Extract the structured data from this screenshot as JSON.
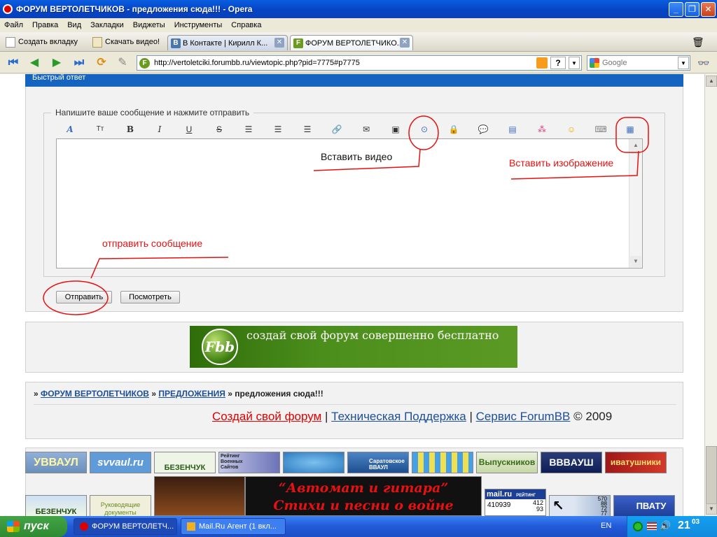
{
  "window": {
    "title": "ФОРУМ ВЕРТОЛЕТЧИКОВ - предложения сюда!!! - Opera",
    "buttons": {
      "minimize": "_",
      "maximize": "❐",
      "close": "✕"
    }
  },
  "menu": [
    "Файл",
    "Правка",
    "Вид",
    "Закладки",
    "Виджеты",
    "Инструменты",
    "Справка"
  ],
  "tabbar": {
    "new_tab": "Создать вкладку",
    "download_video": "Скачать видео!",
    "tabs": [
      {
        "label": "В Контакте | Кирилл К...",
        "favicon": "B",
        "active": false
      },
      {
        "label": "ФОРУМ ВЕРТОЛЕТЧИКО...",
        "favicon": "F",
        "active": true
      }
    ]
  },
  "address": {
    "url": "http://vertoletciki.forumbb.ru/viewtopic.php?pid=7775#p7775",
    "search_placeholder": "Google"
  },
  "page": {
    "quick_reply_title": "Быстрый ответ",
    "legend": "Напишите ваше сообщение и нажмите отправить",
    "submit_label": "Отправить",
    "preview_label": "Посмотреть",
    "annotations": {
      "insert_video": "Вставить видео",
      "insert_image": "Вставить изображение",
      "send_message": "отправить сообщение"
    },
    "promo_text": "создай свой форум совершенно бесплатно",
    "promo_logo": "Fbb",
    "breadcrumb": {
      "sep": "»",
      "forum": "ФОРУМ ВЕРТОЛЕТЧИКОВ",
      "section": "ПРЕДЛОЖЕНИЯ",
      "topic": "предложения сюда!!!"
    },
    "footer": {
      "create_forum": "Создай свой форум",
      "support": "Техническая Поддержка",
      "service": "Сервис ForumBB",
      "copyright": "© 2009",
      "divider": "|"
    },
    "banners": {
      "uvvaul": "УВВАУЛ",
      "svvaul": "svvaul.ru",
      "bezenchuk": "БЕЗЕНЧУК",
      "rating_line1": "Рейтинг",
      "rating_line2": "Военных",
      "rating_line3": "Сайтов",
      "saratov_line1": "Саратовское",
      "saratov_line2": "ВВАУЛ",
      "graduates": "Выпускников",
      "bvvaush": "BBBAУШ",
      "ivatushniki": "иватушники",
      "bezenchuk2": "БЕЗЕНЧУК",
      "guide_line1": "Руководящие",
      "guide_line2": "документы",
      "song_line1": "“Автомат и гитара”",
      "song_line2": "Стихи и песни о войне",
      "mail_logo": "mail.ru",
      "mail_rating": "РЕЙТИНГ",
      "mail_count": "410939",
      "mail_a": "412",
      "mail_b": "93",
      "counter_a": "570",
      "counter_b": "88",
      "counter_c": "72",
      "counter_d": "77",
      "pvatu": "ПВАТУ"
    }
  },
  "taskbar": {
    "start": "пуск",
    "tasks": [
      {
        "label": "ФОРУМ ВЕРТОЛЕТЧ...",
        "active": true
      },
      {
        "label": "Mail.Ru Агент (1 вкл...",
        "active": false
      }
    ],
    "lang": "EN",
    "time_hour": "21",
    "time_min": "03"
  },
  "colors": {
    "accent": "#1565c0",
    "annotation": "#e81010",
    "link": "#1d4f97",
    "promo_green": "#4c8e1c"
  },
  "icons": {
    "toolbar": [
      "font-color-icon",
      "font-size-icon",
      "bold-icon",
      "italic-icon",
      "underline-icon",
      "strikethrough-icon",
      "align-left-icon",
      "align-center-icon",
      "align-right-icon",
      "link-icon",
      "email-icon",
      "image-icon",
      "video-icon",
      "lock-icon",
      "quote-icon",
      "code-icon",
      "color-icon",
      "smiley-icon",
      "keyboard-icon",
      "insert-image-icon"
    ]
  }
}
